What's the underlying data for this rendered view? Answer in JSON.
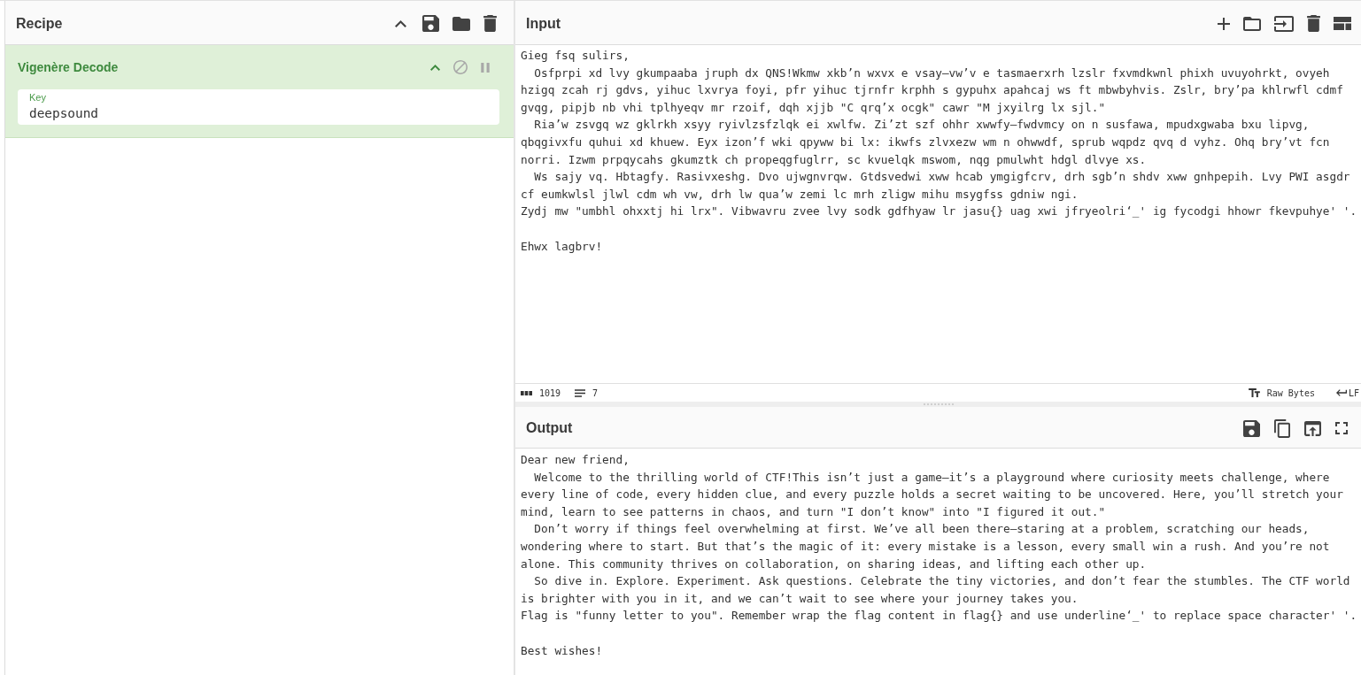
{
  "recipe": {
    "title": "Recipe",
    "operations": [
      {
        "name": "Vigenère Decode",
        "disabled": false,
        "breakpoint": false,
        "args": [
          {
            "label": "Key",
            "value": "deepsound"
          }
        ]
      }
    ]
  },
  "input": {
    "title": "Input",
    "value": "Gieg fsq sulirs,\n  Osfprpi xd lvy gkumpaaba jruph dx QNS!Wkmw xkb’n wxvx e vsay—vw’v e tasmaerxrh lzslr fxvmdkwnl phixh uvuyohrkt, ovyeh hzigq zcah rj gdvs, yihuc lxvrya foyi, pfr yihuc tjrnfr krphh s gypuhx apahcaj ws ft mbwbyhvis. Zslr, bry’pa khlrwfl cdmf gvqg, pipjb nb vhi tplhyeqv mr rzoif, dqh xjjb \"C qrq’x ocgk\" cawr \"M jxyilrg lx sjl.\"\n  Ria’w zsvgq wz gklrkh xsyy ryivlzsfzlqk ei xwlfw. Zi’zt szf ohhr xwwfy—fwdvmcy on n susfawa, mpudxgwaba bxu lipvg, qbqgivxfu quhui xd khuew. Eyx izon’f wki qpyww bi lx: ikwfs zlvxezw wm n ohwwdf, sprub wqpdz qvq d vyhz. Ohq bry’vt fcn norri. Izwm prpqycahs gkumztk ch propeqgfuglrr, sc kvuelqk mswom, nqg pmulwht hdgl dlvye xs.\n  Ws sajy vq. Hbtagfy. Rasivxeshg. Dvo ujwgnvrqw. Gtdsvedwi xww hcab ymgigfcrv, drh sgb’n shdv xww gnhpepih. Lvy PWI asgdr cf eumkwlsl jlwl cdm wh vw, drh lw qua’w zemi lc mrh zligw mihu msygfss gdniw ngi.\nZydj mw \"umbhl ohxxtj hi lrx\". Vibwavru zvee lvy sodk gdfhyaw lr jasu{} uag xwi jfryeolri‘_' ig fycodgi hhowr fkevpuhye' '.\n\nEhwx lagbrv!"
  },
  "status_bar": {
    "characters": "1019",
    "lines": "7",
    "encoding": "Raw Bytes",
    "line_ending": "LF"
  },
  "output": {
    "title": "Output",
    "text": "Dear new friend,\n  Welcome to the thrilling world of CTF!This isn’t just a game—it’s a playground where curiosity meets challenge, where every line of code, every hidden clue, and every puzzle holds a secret waiting to be uncovered. Here, you’ll stretch your mind, learn to see patterns in chaos, and turn \"I don’t know\" into \"I figured it out.\"\n  Don’t worry if things feel overwhelming at first. We’ve all been there—staring at a problem, scratching our heads, wondering where to start. But that’s the magic of it: every mistake is a lesson, every small win a rush. And you’re not alone. This community thrives on collaboration, on sharing ideas, and lifting each other up.\n  So dive in. Explore. Experiment. Ask questions. Celebrate the tiny victories, and don’t fear the stumbles. The CTF world is brighter with you in it, and we can’t wait to see where your journey takes you.\nFlag is \"funny letter to you\". Remember wrap the flag content in flag{} and use underline‘_' to replace space character' '.\n\nBest wishes!"
  }
}
